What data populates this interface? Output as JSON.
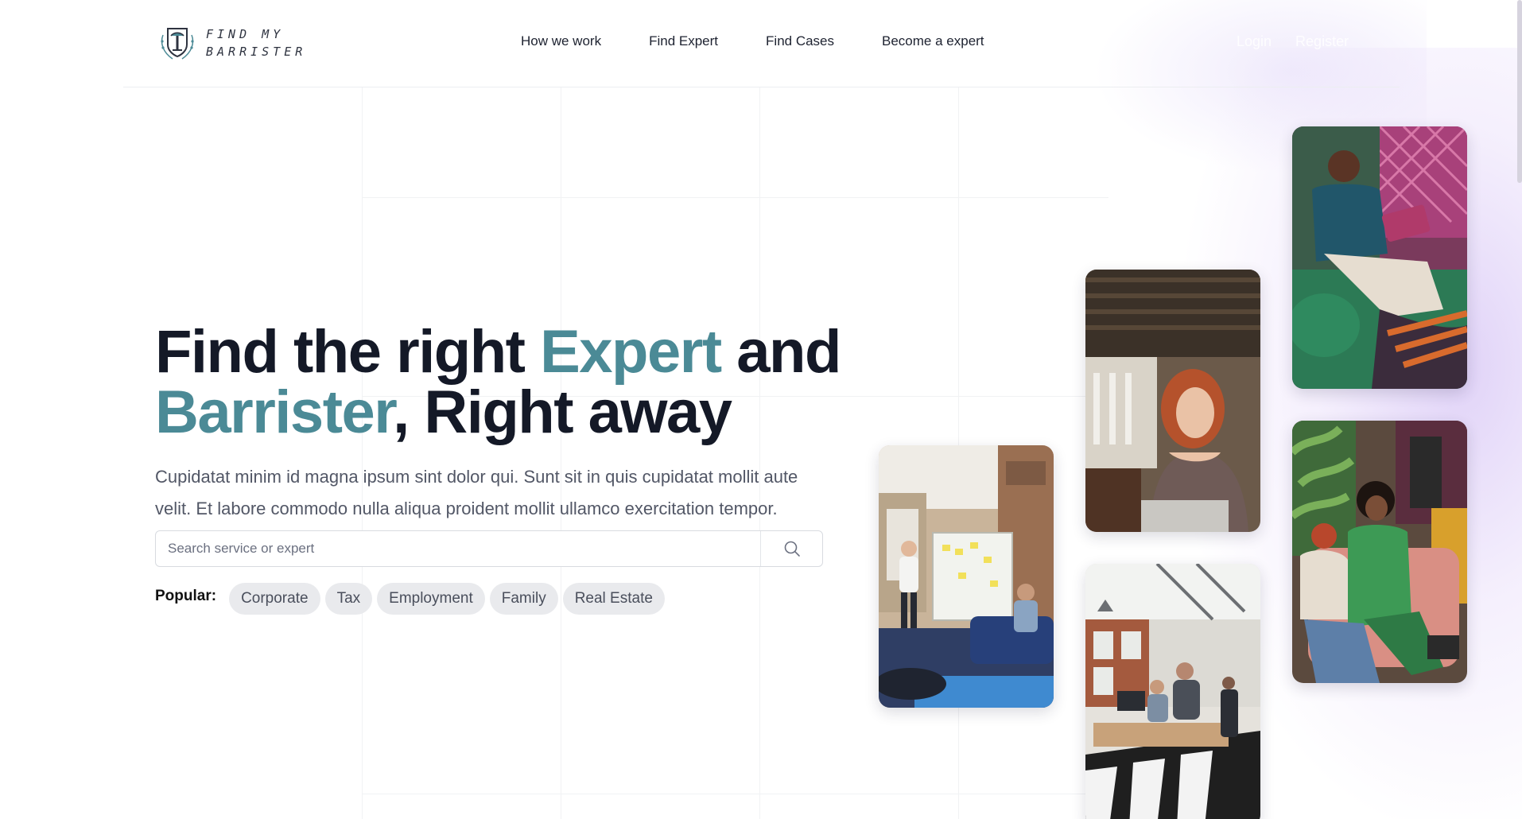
{
  "brand": {
    "name_line1": "FIND MY",
    "name_line2": "BARRISTER",
    "logo_icon": "shield-tree-icon"
  },
  "nav": {
    "items": [
      {
        "label": "How we work"
      },
      {
        "label": "Find Expert"
      },
      {
        "label": "Find Cases"
      },
      {
        "label": "Become a expert"
      }
    ]
  },
  "auth": {
    "login_label": "Login",
    "register_label": "Register"
  },
  "hero": {
    "title_part1": "Find the right ",
    "title_accent1": "Expert",
    "title_part2": " and",
    "title_accent2": "Barrister",
    "title_part3": ", Right away",
    "description": "Cupidatat minim id magna ipsum sint dolor qui. Sunt sit in quis cupidatat mollit aute velit. Et labore commodo nulla aliqua proident mollit ullamco exercitation tempor."
  },
  "search": {
    "placeholder": "Search service or expert",
    "value": "",
    "icon": "search-icon"
  },
  "popular": {
    "label": "Popular:",
    "tags": [
      "Corporate",
      "Tax",
      "Employment",
      "Family",
      "Real Estate"
    ]
  },
  "colors": {
    "accent": "#4b8a96",
    "heading": "#141927",
    "chip_bg": "#e9eaed",
    "glow": "#d6c4f5"
  },
  "photos": [
    {
      "name": "team-whiteboard-photo"
    },
    {
      "name": "woman-laptop-photo"
    },
    {
      "name": "open-office-photo"
    },
    {
      "name": "man-tablet-photo"
    },
    {
      "name": "women-chatting-photo"
    }
  ]
}
